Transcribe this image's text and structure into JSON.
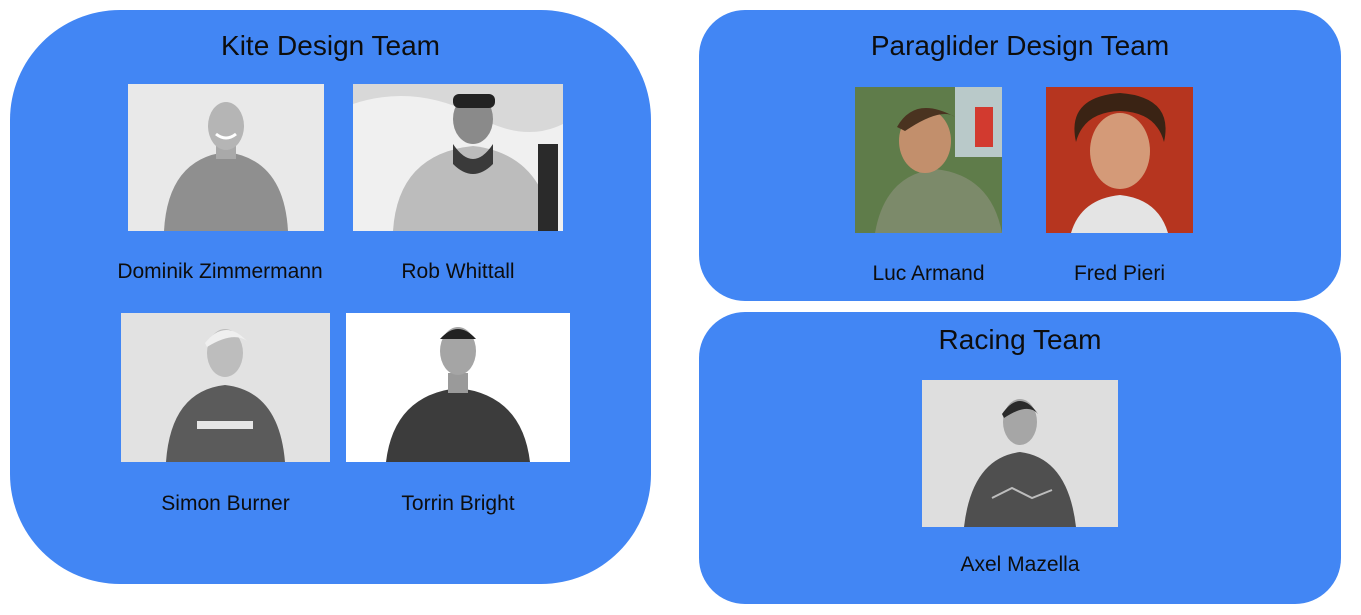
{
  "colors": {
    "panel": "#4286f4",
    "text": "#0d0d0d"
  },
  "teams": {
    "kite": {
      "title": "Kite Design Team",
      "members": [
        {
          "name": "Dominik Zimmermann",
          "photo": "portrait-bw"
        },
        {
          "name": "Rob Whittall",
          "photo": "portrait-bw"
        },
        {
          "name": "Simon Burner",
          "photo": "portrait-bw"
        },
        {
          "name": "Torrin Bright",
          "photo": "portrait-bw"
        }
      ]
    },
    "paraglider": {
      "title": "Paraglider Design Team",
      "members": [
        {
          "name": "Luc Armand",
          "photo": "portrait-color"
        },
        {
          "name": "Fred Pieri",
          "photo": "portrait-color"
        }
      ]
    },
    "racing": {
      "title": "Racing Team",
      "members": [
        {
          "name": "Axel Mazella",
          "photo": "portrait-bw"
        }
      ]
    }
  }
}
